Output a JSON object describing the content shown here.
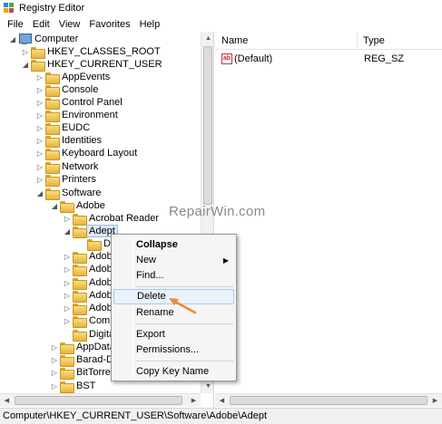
{
  "window": {
    "title": "Registry Editor"
  },
  "menu": [
    "File",
    "Edit",
    "View",
    "Favorites",
    "Help"
  ],
  "tree": {
    "rows": [
      {
        "label": "Computer",
        "icon": "computer-icon",
        "expander": "expanded"
      },
      {
        "label": "HKEY_CLASSES_ROOT",
        "icon": "folder-icon",
        "expander": "collapsed"
      },
      {
        "label": "HKEY_CURRENT_USER",
        "icon": "folder-icon",
        "expander": "expanded"
      },
      {
        "label": "AppEvents",
        "icon": "folder-icon",
        "expander": "collapsed"
      },
      {
        "label": "Console",
        "icon": "folder-icon",
        "expander": "collapsed"
      },
      {
        "label": "Control Panel",
        "icon": "folder-icon",
        "expander": "collapsed"
      },
      {
        "label": "Environment",
        "icon": "folder-icon",
        "expander": "collapsed"
      },
      {
        "label": "EUDC",
        "icon": "folder-icon",
        "expander": "collapsed"
      },
      {
        "label": "Identities",
        "icon": "folder-icon",
        "expander": "collapsed"
      },
      {
        "label": "Keyboard Layout",
        "icon": "folder-icon",
        "expander": "collapsed"
      },
      {
        "label": "Network",
        "icon": "folder-icon",
        "expander": "collapsed"
      },
      {
        "label": "Printers",
        "icon": "folder-icon",
        "expander": "collapsed"
      },
      {
        "label": "Software",
        "icon": "folder-icon",
        "expander": "expanded"
      },
      {
        "label": "Adobe",
        "icon": "folder-icon",
        "expander": "expanded"
      },
      {
        "label": "Acrobat Reader",
        "icon": "folder-icon",
        "expander": "collapsed"
      },
      {
        "label": "Adept",
        "icon": "folder-icon",
        "expander": "expanded",
        "selected": true
      },
      {
        "label": "De",
        "icon": "folder-icon",
        "expander": "none"
      },
      {
        "label": "Adobe",
        "icon": "folder-icon",
        "expander": "collapsed"
      },
      {
        "label": "Adobe",
        "icon": "folder-icon",
        "expander": "collapsed"
      },
      {
        "label": "Adobe",
        "icon": "folder-icon",
        "expander": "collapsed"
      },
      {
        "label": "Adobe",
        "icon": "folder-icon",
        "expander": "collapsed"
      },
      {
        "label": "Adobe",
        "icon": "folder-icon",
        "expander": "collapsed"
      },
      {
        "label": "Comm",
        "icon": "folder-icon",
        "expander": "collapsed"
      },
      {
        "label": "Digita",
        "icon": "folder-icon",
        "expander": "none"
      },
      {
        "label": "AppDataL",
        "icon": "folder-icon",
        "expander": "collapsed"
      },
      {
        "label": "Barad-Du",
        "icon": "folder-icon",
        "expander": "collapsed"
      },
      {
        "label": "BitTorren",
        "icon": "folder-icon",
        "expander": "collapsed"
      },
      {
        "label": "BST",
        "icon": "folder-icon",
        "expander": "collapsed"
      }
    ]
  },
  "list": {
    "columns": [
      "Name",
      "Type"
    ],
    "rows": [
      {
        "name": "(Default)",
        "type": "REG_SZ",
        "icon": "string-value-icon"
      }
    ]
  },
  "context_menu": {
    "items": [
      {
        "label": "Collapse",
        "bold": true
      },
      {
        "label": "New",
        "submenu": true
      },
      {
        "label": "Find..."
      },
      {
        "label": "Delete",
        "highlighted": true
      },
      {
        "label": "Rename"
      },
      {
        "label": "Export"
      },
      {
        "label": "Permissions..."
      },
      {
        "label": "Copy Key Name"
      }
    ]
  },
  "watermark": "RepairWin.com",
  "status": {
    "path": "Computer\\HKEY_CURRENT_USER\\Software\\Adobe\\Adept"
  },
  "colors": {
    "accent_arrow": "#f08a2a",
    "selection": "#dde9f7"
  }
}
